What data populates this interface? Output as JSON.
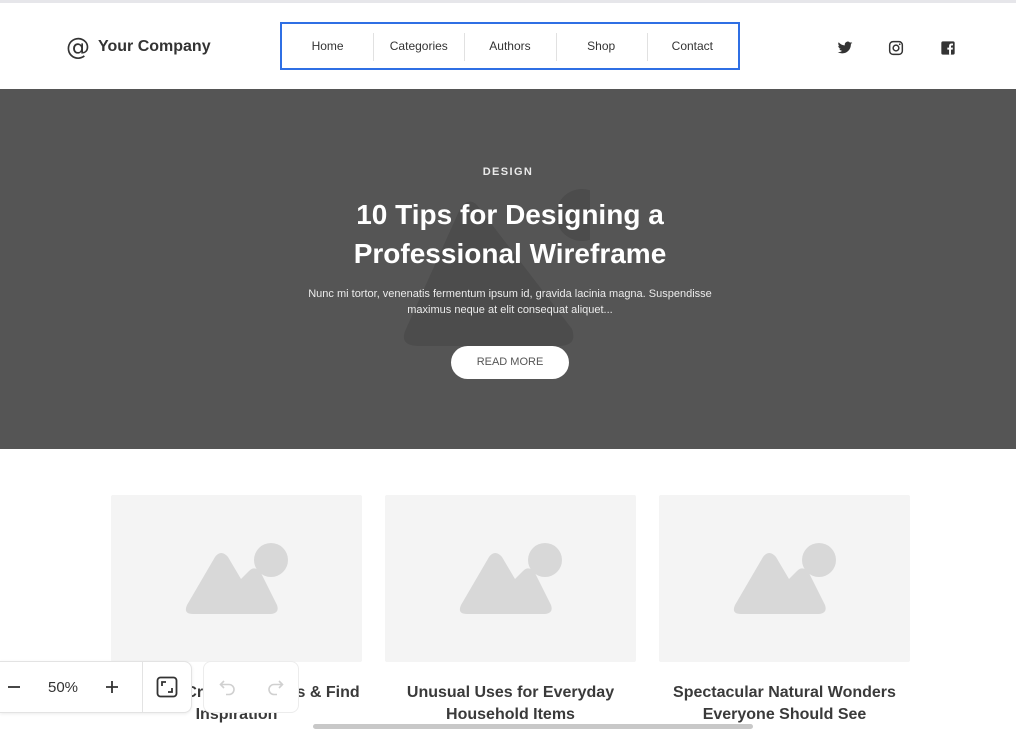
{
  "brand": {
    "name": "Your Company",
    "logo_icon": "at-sign-icon"
  },
  "nav": {
    "items": [
      "Home",
      "Categories",
      "Authors",
      "Shop",
      "Contact"
    ]
  },
  "social": [
    "twitter-icon",
    "instagram-icon",
    "facebook-icon"
  ],
  "hero": {
    "category": "DESIGN",
    "title": "10 Tips for Designing a Professional Wireframe",
    "excerpt": "Nunc mi tortor, venenatis fermentum ipsum id, gravida lacinia magna. Suspendisse maximus neque at elit consequat aliquet...",
    "button": "READ MORE"
  },
  "cards": [
    {
      "title": "Get Over Creative Blocks & Find Inspiration"
    },
    {
      "title": "Unusual Uses for Everyday Household Items"
    },
    {
      "title": "Spectacular Natural Wonders Everyone Should See"
    }
  ],
  "toolbar": {
    "zoom": "50%"
  },
  "colors": {
    "accent": "#2f6fe4",
    "hero_bg": "#555555",
    "card_bg": "#f4f4f4"
  }
}
